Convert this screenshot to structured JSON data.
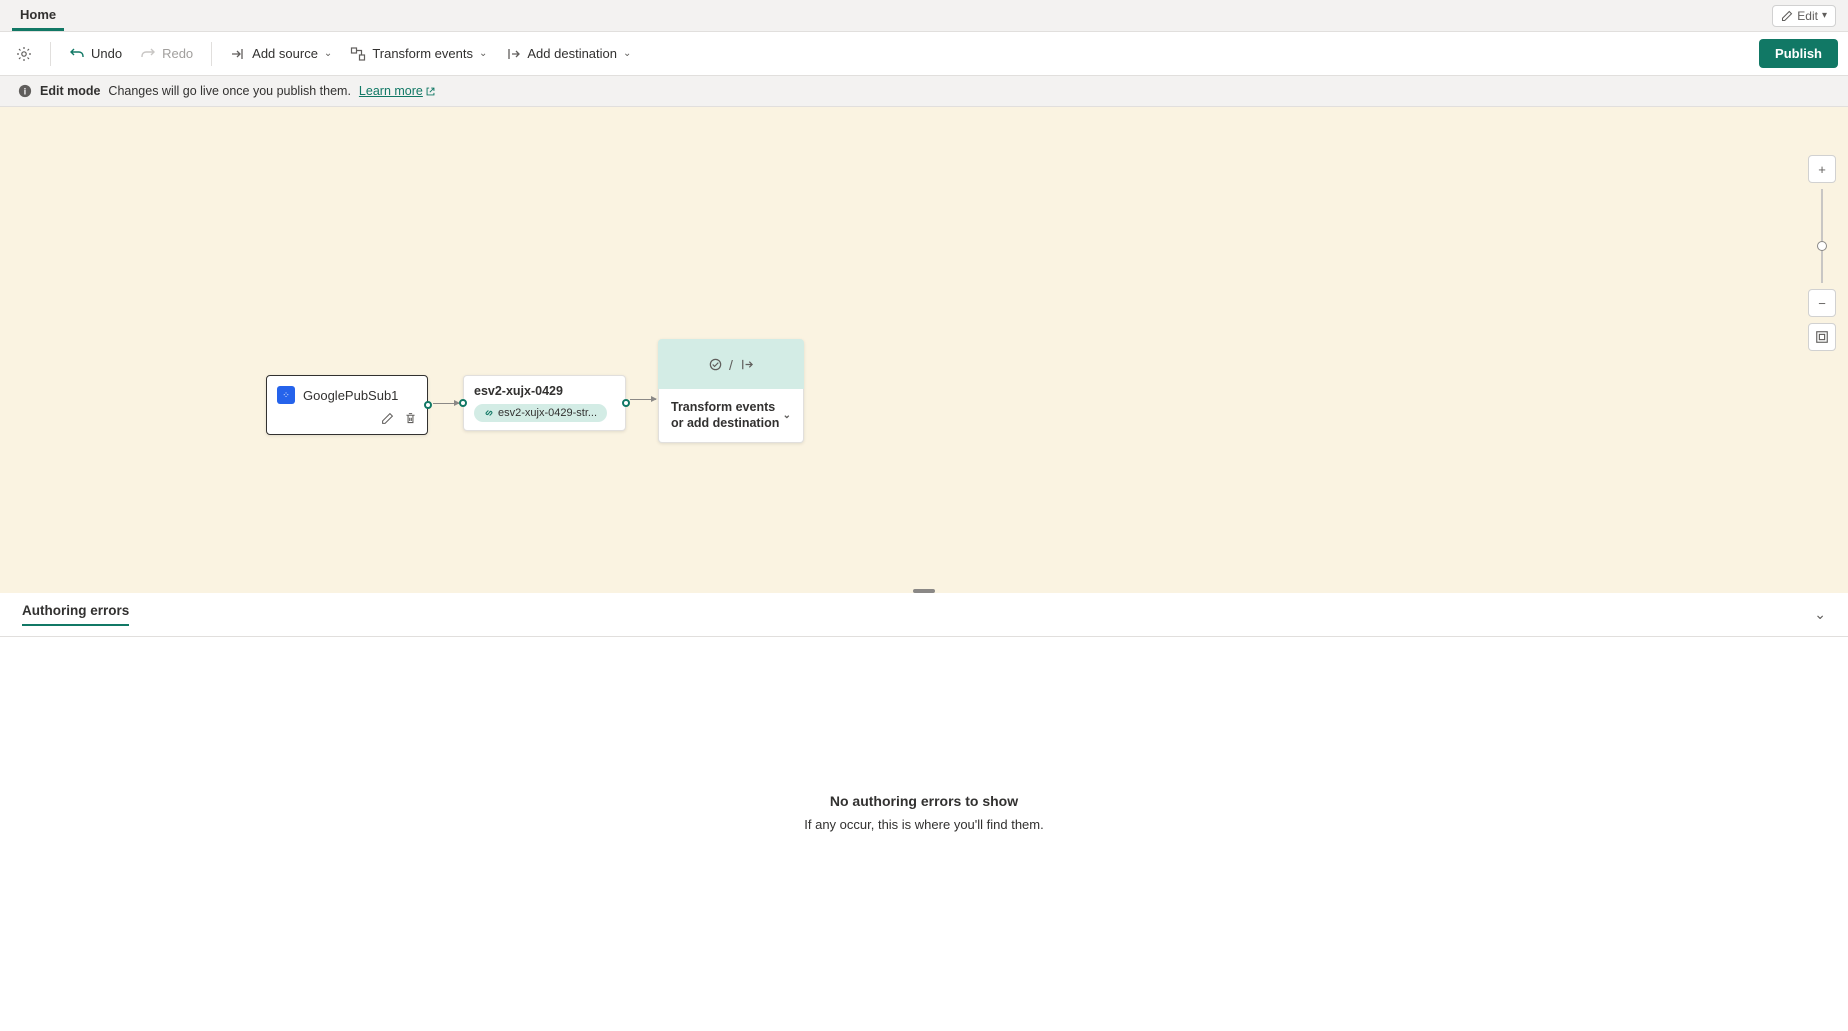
{
  "tabs": {
    "home": "Home"
  },
  "editToggle": {
    "label": "Edit"
  },
  "toolbar": {
    "undo": "Undo",
    "redo": "Redo",
    "addSource": "Add source",
    "transform": "Transform events",
    "addDest": "Add destination",
    "publish": "Publish"
  },
  "infoBar": {
    "mode": "Edit mode",
    "message": "Changes will go live once you publish them.",
    "learnMore": "Learn more"
  },
  "nodes": {
    "source": {
      "title": "GooglePubSub1"
    },
    "mid": {
      "title": "esv2-xujx-0429",
      "chip": "esv2-xujx-0429-str..."
    },
    "dest": {
      "label": "Transform events or add destination"
    }
  },
  "panel": {
    "tab": "Authoring errors",
    "emptyTitle": "No authoring errors to show",
    "emptyBody": "If any occur, this is where you'll find them."
  }
}
